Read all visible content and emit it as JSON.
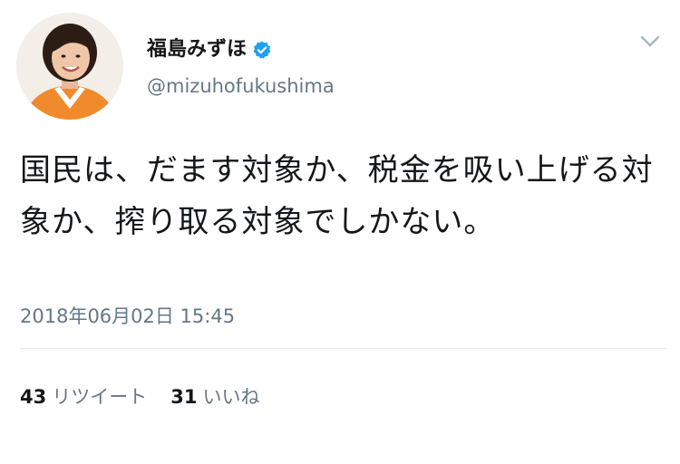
{
  "tweet": {
    "display_name": "福島みずほ",
    "handle": "@mizuhofukushima",
    "text": "国民は、だます対象か、税金を吸い上げる対象か、搾り取る対象でしかない。",
    "timestamp": "2018年06月02日 15:45",
    "retweets": {
      "count": "43",
      "label": "リツイート"
    },
    "likes": {
      "count": "31",
      "label": "いいね"
    }
  },
  "icons": {
    "verified": "verified-badge-icon",
    "menu": "chevron-down-icon"
  },
  "colors": {
    "verified_blue": "#1da1f2",
    "secondary_text": "#657786",
    "primary_text": "#14171a",
    "divider": "#e1e8ed"
  }
}
